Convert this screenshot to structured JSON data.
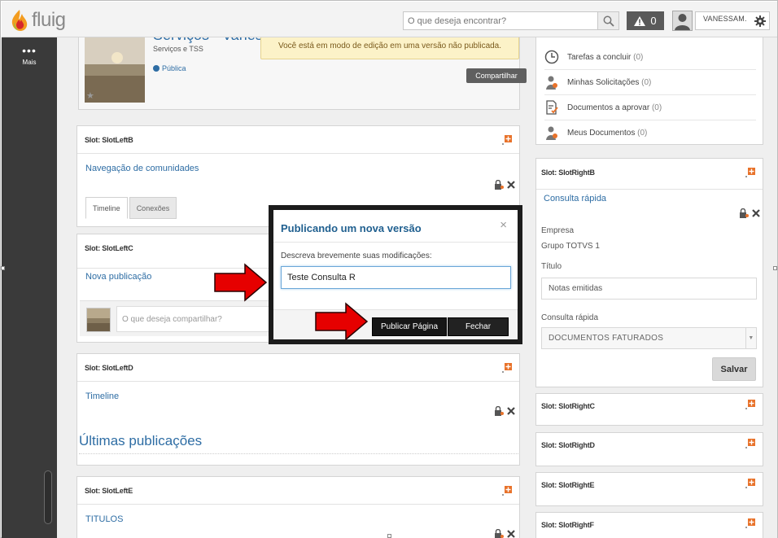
{
  "app": {
    "logo_text": "fluig"
  },
  "header": {
    "search_placeholder": "O que deseja encontrar?",
    "alerts_count": "0",
    "user_name": "VANESSAM."
  },
  "sidebar": {
    "more_label": "Mais"
  },
  "community": {
    "name": "Serviços - Vaness",
    "subtitle": "Serviços e TSS",
    "visibility": "Pública",
    "share_label": "Compartilhar"
  },
  "edit_warning": "Você está em modo de edição em uma versão não publicada.",
  "left_slots": [
    {
      "title": "Slot: SlotLeftB",
      "widget": "Navegação de comunidades",
      "tabs": [
        "Timeline",
        "Conexões"
      ]
    },
    {
      "title": "Slot: SlotLeftC",
      "widget": "Nova publicação",
      "composer_placeholder": "O que deseja compartilhar?"
    },
    {
      "title": "Slot: SlotLeftD",
      "widget": "Timeline",
      "section_heading": "Últimas publicações"
    },
    {
      "title": "Slot: SlotLeftE",
      "widget": "TITULOS"
    }
  ],
  "right_list": [
    {
      "label": "Tarefas a concluir",
      "count": "(0)",
      "icon": "clock-icon"
    },
    {
      "label": "Minhas Solicitações",
      "count": "(0)",
      "icon": "person-icon"
    },
    {
      "label": "Documentos a aprovar",
      "count": "(0)",
      "icon": "document-check-icon"
    },
    {
      "label": "Meus Documentos",
      "count": "(0)",
      "icon": "person-icon"
    }
  ],
  "right_slots": [
    {
      "title": "Slot: SlotRightB",
      "widget": "Consulta rápida",
      "company_label": "Empresa",
      "company_value": "Grupo TOTVS 1",
      "title_label": "Título",
      "title_value": "Notas emitidas",
      "query_label": "Consulta rápida",
      "query_value": "DOCUMENTOS FATURADOS",
      "save_label": "Salvar"
    },
    {
      "title": "Slot: SlotRightC"
    },
    {
      "title": "Slot: SlotRightD"
    },
    {
      "title": "Slot: SlotRightE"
    },
    {
      "title": "Slot: SlotRightF"
    }
  ],
  "modal": {
    "title": "Publicando um nova versão",
    "prompt": "Descreva brevemente suas modificações:",
    "input_value": "Teste Consulta R",
    "publish_label": "Publicar Página",
    "close_label": "Fechar"
  },
  "colors": {
    "accent_blue": "#2e6da4",
    "sidebar": "#3a3a3a",
    "warning_bg": "#fcf2c8",
    "slot_add_orange": "#e8722a",
    "arrow_red": "#e60000"
  }
}
